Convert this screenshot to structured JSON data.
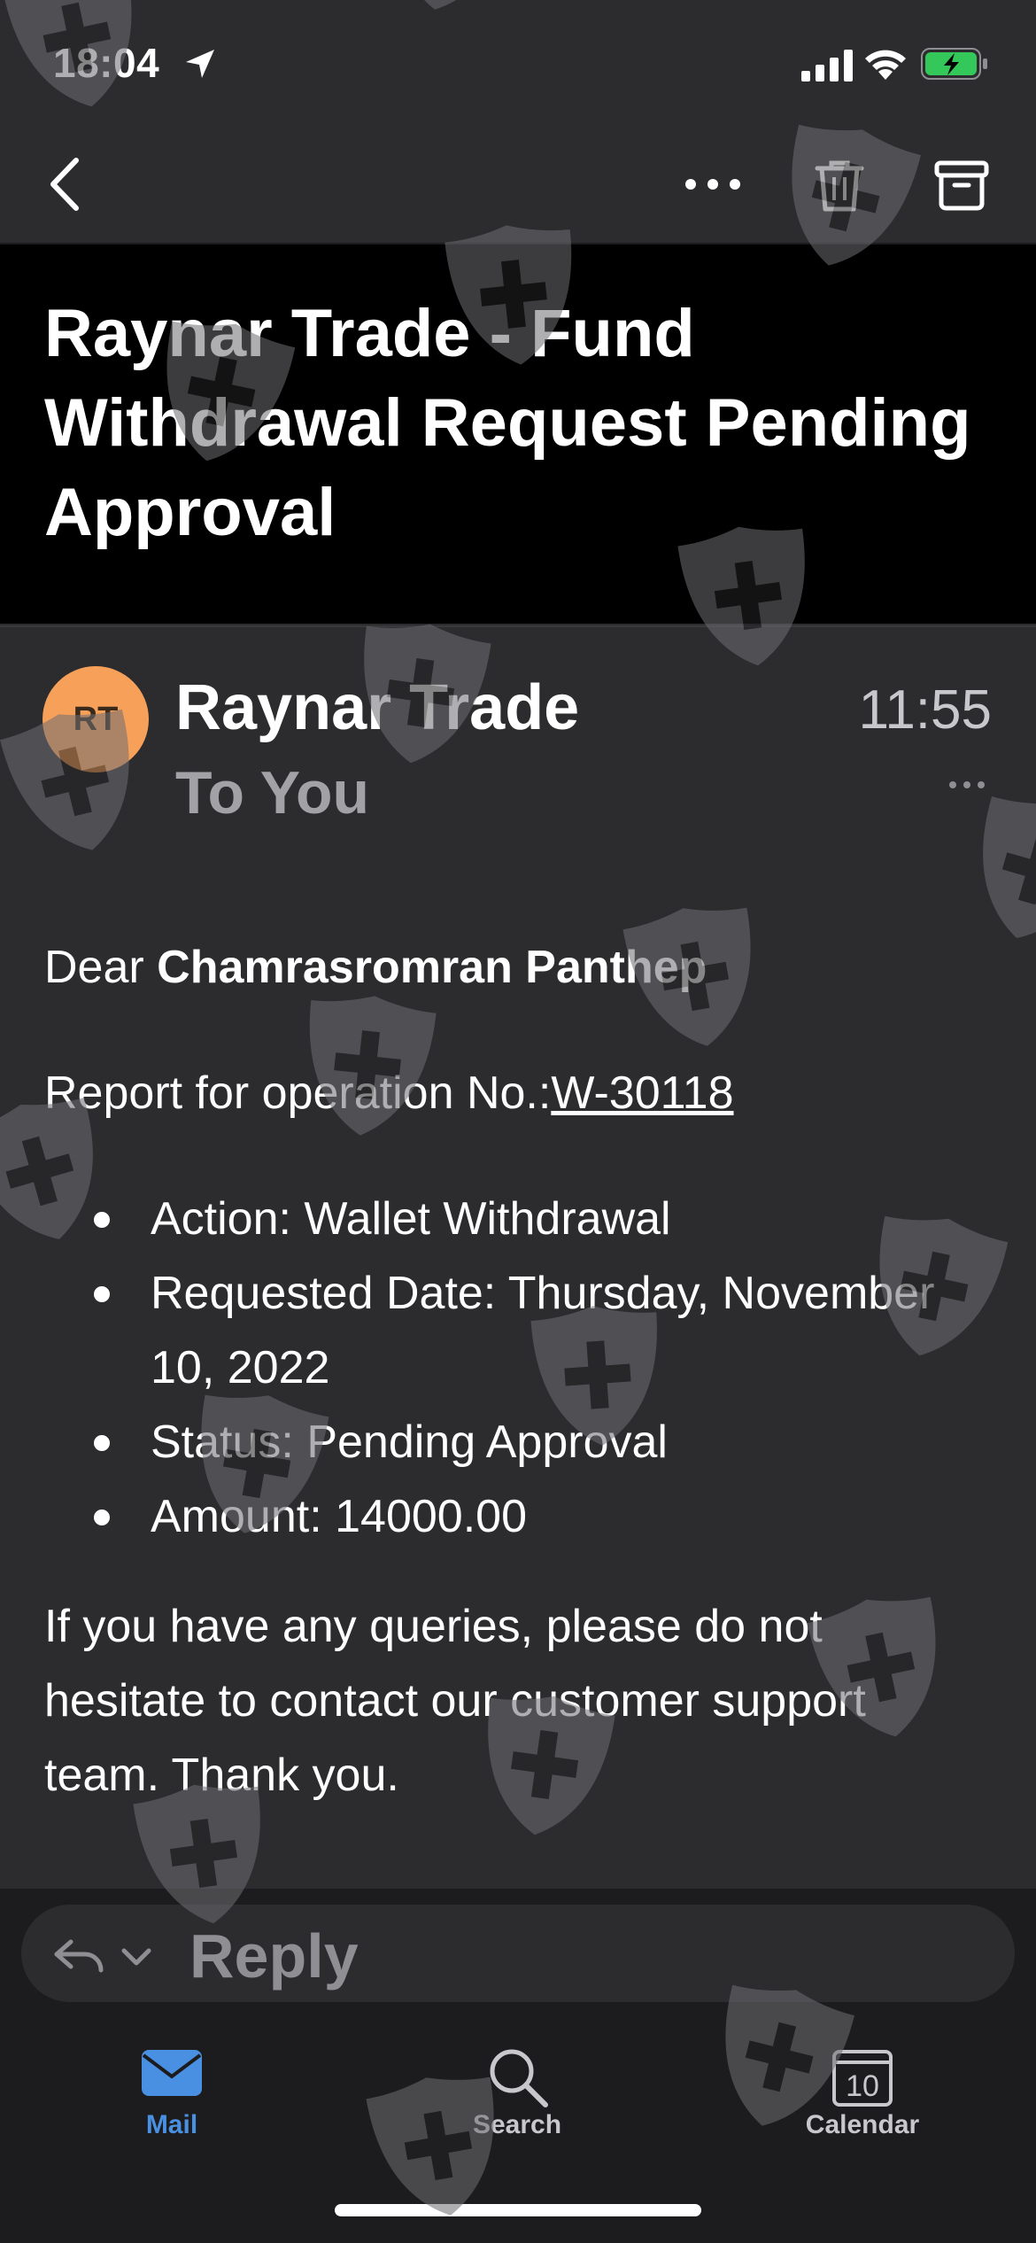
{
  "status_bar": {
    "time": "18:04"
  },
  "email": {
    "subject": "Raynar Trade - Fund Withdrawal Request Pending Approval",
    "sender_initials": "RT",
    "sender_name": "Raynar Trade",
    "recipient_line": "To You",
    "time": "11:55",
    "greeting_prefix": "Dear ",
    "recipient_name": "Chamrasromran Panthep",
    "report_prefix": "Report for operation No.:",
    "operation_number": "W-30118",
    "details": [
      "Action: Wallet Withdrawal",
      "Requested Date: Thursday, November 10, 2022",
      "Status: Pending Approval",
      "Amount: 14000.00"
    ],
    "closing": "If you have any queries, please do not hesitate to contact our customer support team. Thank you."
  },
  "reply": {
    "label": "Reply"
  },
  "tabs": [
    {
      "label": "Mail",
      "icon": "envelope-icon",
      "active": true
    },
    {
      "label": "Search",
      "icon": "magnifier-icon",
      "active": false
    },
    {
      "label": "Calendar",
      "icon": "calendar-icon",
      "active": false,
      "badge": "10"
    }
  ],
  "colors": {
    "background": "#2c2c2e",
    "subject_background": "#000000",
    "avatar": "#f6a05a",
    "active_tab": "#4a90e2",
    "inactive_tab": "#c7c7cc",
    "muted_text": "#a1a1a6"
  }
}
